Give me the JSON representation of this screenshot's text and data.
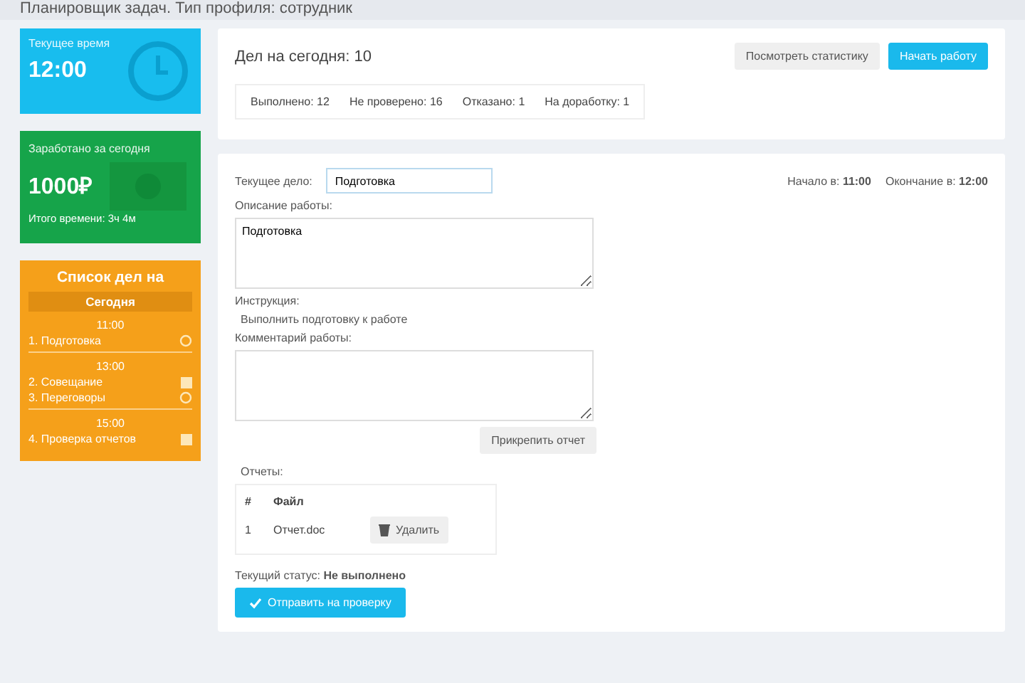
{
  "header": {
    "title": "Планировщик задач. Тип профиля: сотрудник"
  },
  "time_card": {
    "label": "Текущее время",
    "value": "12:00"
  },
  "earned_card": {
    "label": "Заработано за сегодня",
    "value": "1000₽",
    "total": "Итого времени: 3ч 4м"
  },
  "todo_card": {
    "title": "Список дел на",
    "day": "Сегодня",
    "groups": [
      {
        "time": "11:00",
        "items": [
          {
            "label": "1. Подготовка",
            "kind": "circle"
          }
        ]
      },
      {
        "time": "13:00",
        "items": [
          {
            "label": "2. Совещание",
            "kind": "square"
          },
          {
            "label": "3. Переговоры",
            "kind": "circle"
          }
        ]
      },
      {
        "time": "15:00",
        "items": [
          {
            "label": "4. Проверка отчетов",
            "kind": "square"
          }
        ]
      }
    ]
  },
  "summary": {
    "title": "Дел на сегодня: 10",
    "buttons": [
      {
        "label": "Посмотреть статистику",
        "kind": "secondary"
      },
      {
        "label": "Начать работу",
        "kind": "primary"
      }
    ],
    "counters": [
      "Выполнено: 12",
      "Не проверено: 16",
      "Отказано: 1",
      "На доработку: 1"
    ]
  },
  "task": {
    "current_label": "Текущее дело:",
    "current_value": "Подготовка",
    "start": "Начало в: **11:00**",
    "end": "Окончание в: **12:00**",
    "description_label": "Описание работы:",
    "description_value": "Подготовка",
    "instruction_label": "Инструкция:",
    "instruction_text": "Выполнить подготовку к работе",
    "comment_label": "Комментарий работы:",
    "attach_button": "Прикрепить отчет",
    "reports_label": "Отчеты:",
    "reports_columns": [
      "#",
      "Файл"
    ],
    "reports_rows": [
      {
        "index": "1",
        "file": "Отчет.doc",
        "button": "Удалить"
      }
    ],
    "status": "Текущий статус: **Не выполнено**",
    "submit_button": "Отправить на проверку"
  }
}
